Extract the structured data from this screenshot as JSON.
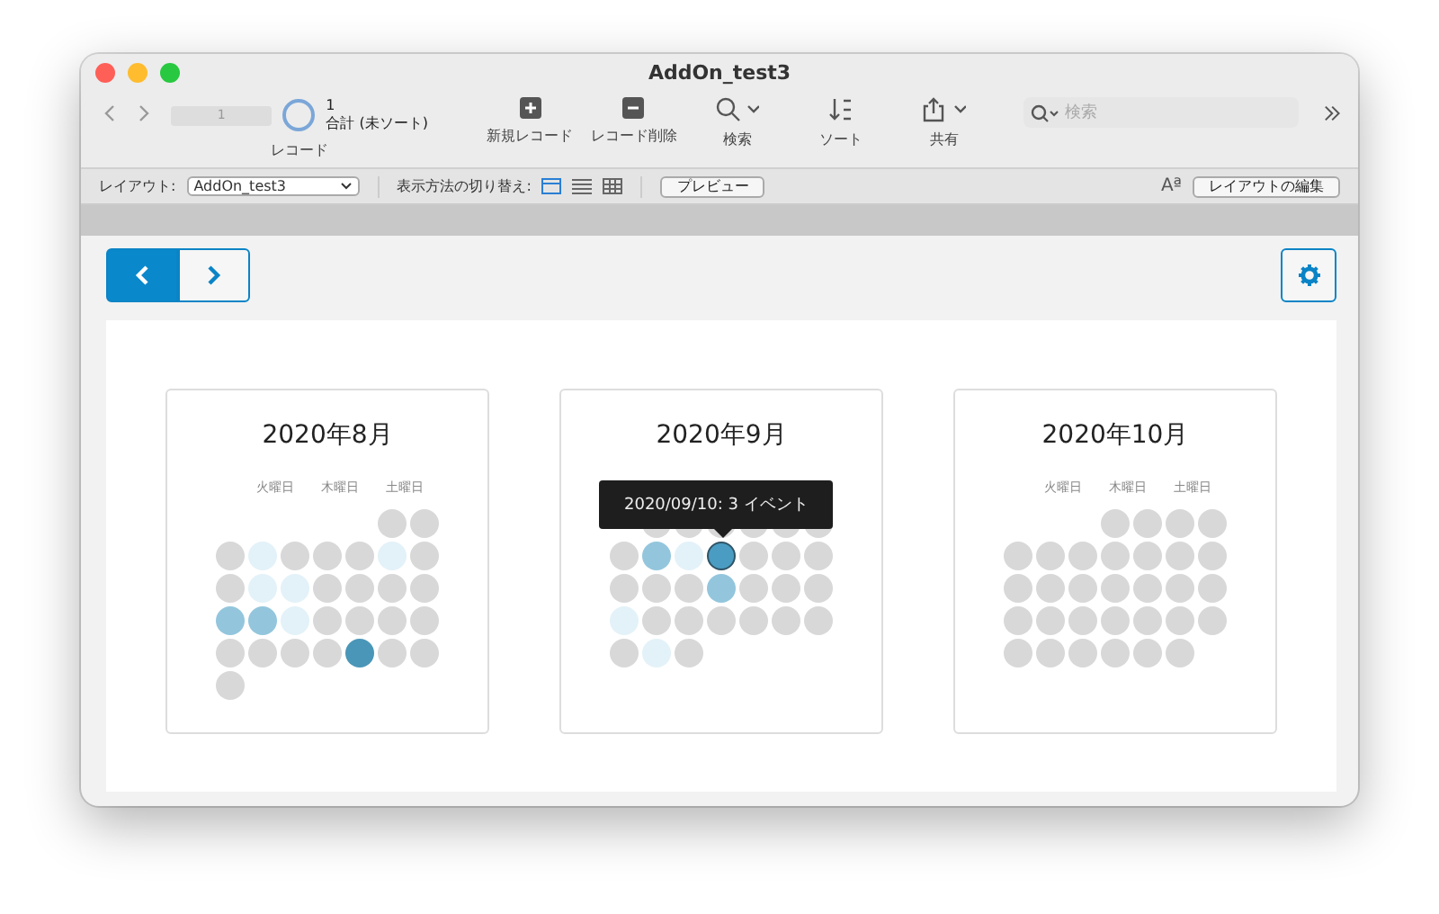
{
  "window": {
    "title": "AddOn_test3"
  },
  "toolbar": {
    "record_field": "1",
    "record_count": "1",
    "record_status": "合計 (未ソート)",
    "record_label": "レコード",
    "buttons": [
      {
        "kind": "new",
        "label": "新規レコード"
      },
      {
        "kind": "delete",
        "label": "レコード削除"
      },
      {
        "kind": "search",
        "label": "検索"
      },
      {
        "kind": "sort",
        "label": "ソート"
      },
      {
        "kind": "share",
        "label": "共有"
      }
    ],
    "search": {
      "placeholder": "検索"
    }
  },
  "layout_bar": {
    "layout_label": "レイアウト:",
    "layout_value": "AddOn_test3",
    "view_label": "表示方法の切り替え:",
    "views": [
      {
        "kind": "form",
        "selected": true
      },
      {
        "kind": "list",
        "selected": false
      },
      {
        "kind": "table",
        "selected": false
      }
    ],
    "preview": "プレビュー",
    "font_icon": "Aª",
    "edit_layout": "レイアウトの編集"
  },
  "months": [
    {
      "title": "2020年8月",
      "weekdays": [
        "火曜日",
        "木曜日",
        "土曜日"
      ],
      "days": [
        {
          "kind": "blank"
        },
        {
          "kind": "blank"
        },
        {
          "kind": "blank"
        },
        {
          "kind": "blank"
        },
        {
          "kind": "blank"
        },
        {
          "kind": "day",
          "color": "#d8d8d8"
        },
        {
          "kind": "day",
          "color": "#d8d8d8"
        },
        {
          "kind": "day",
          "color": "#d8d8d8"
        },
        {
          "kind": "day",
          "color": "#e3f2f8"
        },
        {
          "kind": "day",
          "color": "#d8d8d8"
        },
        {
          "kind": "day",
          "color": "#d8d8d8"
        },
        {
          "kind": "day",
          "color": "#d8d8d8"
        },
        {
          "kind": "day",
          "color": "#e3f2f8"
        },
        {
          "kind": "day",
          "color": "#d8d8d8"
        },
        {
          "kind": "day",
          "color": "#d8d8d8"
        },
        {
          "kind": "day",
          "color": "#e3f2f8"
        },
        {
          "kind": "day",
          "color": "#e3f2f8"
        },
        {
          "kind": "day",
          "color": "#d8d8d8"
        },
        {
          "kind": "day",
          "color": "#d8d8d8"
        },
        {
          "kind": "day",
          "color": "#d8d8d8"
        },
        {
          "kind": "day",
          "color": "#d8d8d8"
        },
        {
          "kind": "day",
          "color": "#93c6dd"
        },
        {
          "kind": "day",
          "color": "#93c6dd"
        },
        {
          "kind": "day",
          "color": "#e3f2f8"
        },
        {
          "kind": "day",
          "color": "#d8d8d8"
        },
        {
          "kind": "day",
          "color": "#d8d8d8"
        },
        {
          "kind": "day",
          "color": "#d8d8d8"
        },
        {
          "kind": "day",
          "color": "#d8d8d8"
        },
        {
          "kind": "day",
          "color": "#d8d8d8"
        },
        {
          "kind": "day",
          "color": "#d8d8d8"
        },
        {
          "kind": "day",
          "color": "#d8d8d8"
        },
        {
          "kind": "day",
          "color": "#d8d8d8"
        },
        {
          "kind": "day",
          "color": "#4a96b8"
        },
        {
          "kind": "day",
          "color": "#d8d8d8"
        },
        {
          "kind": "day",
          "color": "#d8d8d8"
        },
        {
          "kind": "day",
          "color": "#d8d8d8"
        }
      ]
    },
    {
      "title": "2020年9月",
      "tooltip": "2020/09/10: 3 イベント",
      "days": [
        {
          "kind": "blank"
        },
        {
          "kind": "day",
          "color": "#d8d8d8"
        },
        {
          "kind": "day",
          "color": "#d8d8d8"
        },
        {
          "kind": "day",
          "color": "#d8d8d8"
        },
        {
          "kind": "day",
          "color": "#d8d8d8"
        },
        {
          "kind": "day",
          "color": "#d8d8d8"
        },
        {
          "kind": "day",
          "color": "#d8d8d8"
        },
        {
          "kind": "day",
          "color": "#d8d8d8"
        },
        {
          "kind": "day",
          "color": "#93c6dd"
        },
        {
          "kind": "day",
          "color": "#e3f2f8"
        },
        {
          "kind": "hovered",
          "color": "#4a9cc2"
        },
        {
          "kind": "day",
          "color": "#d8d8d8"
        },
        {
          "kind": "day",
          "color": "#d8d8d8"
        },
        {
          "kind": "day",
          "color": "#d8d8d8"
        },
        {
          "kind": "day",
          "color": "#d8d8d8"
        },
        {
          "kind": "day",
          "color": "#d8d8d8"
        },
        {
          "kind": "day",
          "color": "#d8d8d8"
        },
        {
          "kind": "day",
          "color": "#93c6dd"
        },
        {
          "kind": "day",
          "color": "#d8d8d8"
        },
        {
          "kind": "day",
          "color": "#d8d8d8"
        },
        {
          "kind": "day",
          "color": "#d8d8d8"
        },
        {
          "kind": "day",
          "color": "#e3f2f8"
        },
        {
          "kind": "day",
          "color": "#d8d8d8"
        },
        {
          "kind": "day",
          "color": "#d8d8d8"
        },
        {
          "kind": "day",
          "color": "#d8d8d8"
        },
        {
          "kind": "day",
          "color": "#d8d8d8"
        },
        {
          "kind": "day",
          "color": "#d8d8d8"
        },
        {
          "kind": "day",
          "color": "#d8d8d8"
        },
        {
          "kind": "day",
          "color": "#d8d8d8"
        },
        {
          "kind": "day",
          "color": "#e3f2f8"
        },
        {
          "kind": "day",
          "color": "#d8d8d8"
        }
      ]
    },
    {
      "title": "2020年10月",
      "weekdays": [
        "火曜日",
        "木曜日",
        "土曜日"
      ],
      "days": [
        {
          "kind": "blank"
        },
        {
          "kind": "blank"
        },
        {
          "kind": "blank"
        },
        {
          "kind": "day",
          "color": "#d8d8d8"
        },
        {
          "kind": "day",
          "color": "#d8d8d8"
        },
        {
          "kind": "day",
          "color": "#d8d8d8"
        },
        {
          "kind": "day",
          "color": "#d8d8d8"
        },
        {
          "kind": "day",
          "color": "#d8d8d8"
        },
        {
          "kind": "day",
          "color": "#d8d8d8"
        },
        {
          "kind": "day",
          "color": "#d8d8d8"
        },
        {
          "kind": "day",
          "color": "#d8d8d8"
        },
        {
          "kind": "day",
          "color": "#d8d8d8"
        },
        {
          "kind": "day",
          "color": "#d8d8d8"
        },
        {
          "kind": "day",
          "color": "#d8d8d8"
        },
        {
          "kind": "day",
          "color": "#d8d8d8"
        },
        {
          "kind": "day",
          "color": "#d8d8d8"
        },
        {
          "kind": "day",
          "color": "#d8d8d8"
        },
        {
          "kind": "day",
          "color": "#d8d8d8"
        },
        {
          "kind": "day",
          "color": "#d8d8d8"
        },
        {
          "kind": "day",
          "color": "#d8d8d8"
        },
        {
          "kind": "day",
          "color": "#d8d8d8"
        },
        {
          "kind": "day",
          "color": "#d8d8d8"
        },
        {
          "kind": "day",
          "color": "#d8d8d8"
        },
        {
          "kind": "day",
          "color": "#d8d8d8"
        },
        {
          "kind": "day",
          "color": "#d8d8d8"
        },
        {
          "kind": "day",
          "color": "#d8d8d8"
        },
        {
          "kind": "day",
          "color": "#d8d8d8"
        },
        {
          "kind": "day",
          "color": "#d8d8d8"
        },
        {
          "kind": "day",
          "color": "#d8d8d8"
        },
        {
          "kind": "day",
          "color": "#d8d8d8"
        },
        {
          "kind": "day",
          "color": "#d8d8d8"
        },
        {
          "kind": "day",
          "color": "#d8d8d8"
        },
        {
          "kind": "day",
          "color": "#d8d8d8"
        },
        {
          "kind": "day",
          "color": "#d8d8d8"
        }
      ]
    }
  ]
}
